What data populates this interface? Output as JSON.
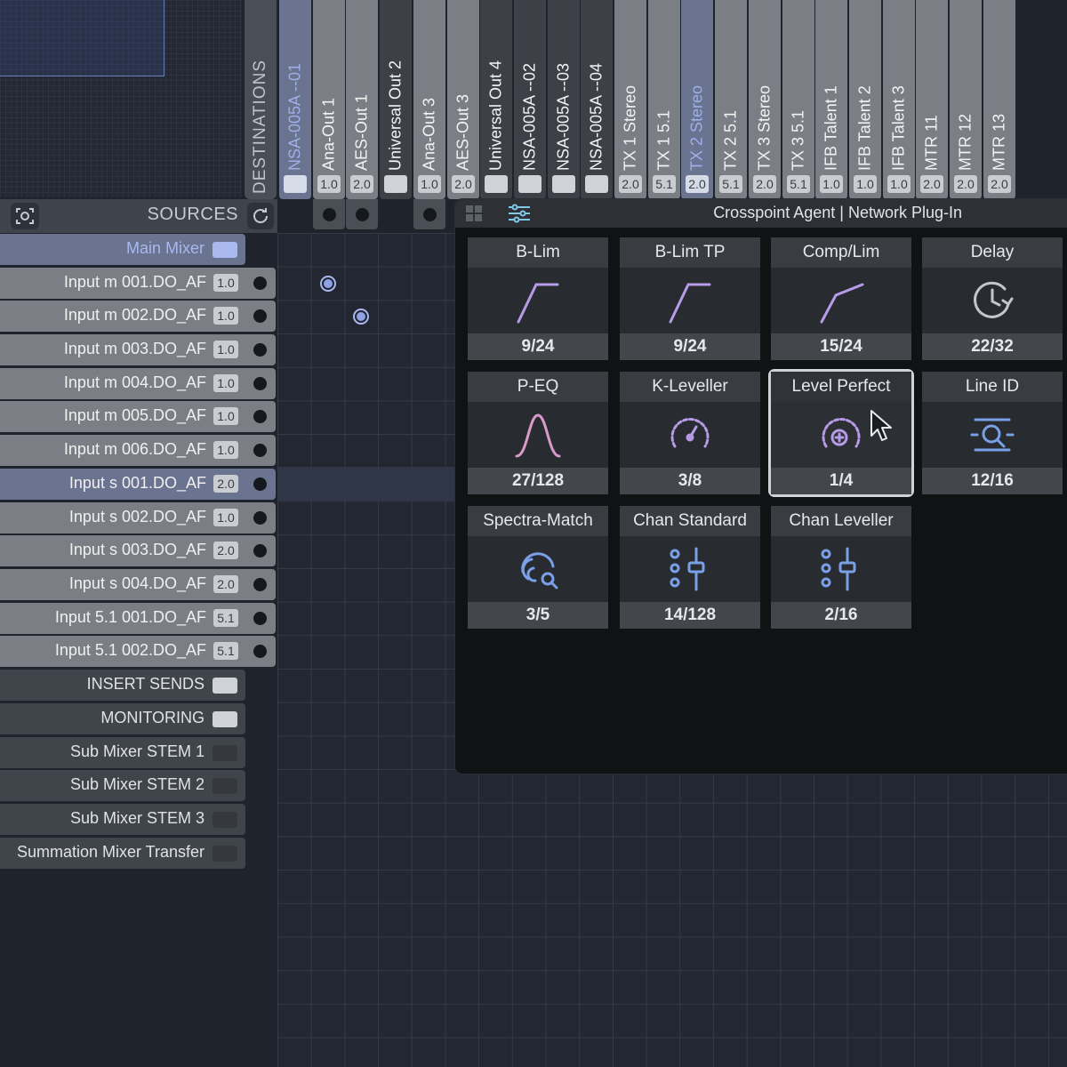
{
  "header": {
    "destinations_label": "DESTINATIONS"
  },
  "sources_bar": {
    "label": "SOURCES"
  },
  "destinations": [
    {
      "name": "NSA-005A --01",
      "badge": ""
    },
    {
      "name": "Ana-Out 1",
      "badge": "1.0"
    },
    {
      "name": "AES-Out 1",
      "badge": "2.0"
    },
    {
      "name": "Universal Out 2",
      "badge": ""
    },
    {
      "name": "Ana-Out 3",
      "badge": "1.0"
    },
    {
      "name": "AES-Out 3",
      "badge": "2.0"
    },
    {
      "name": "Universal Out 4",
      "badge": ""
    },
    {
      "name": "NSA-005A --02",
      "badge": ""
    },
    {
      "name": "NSA-005A --03",
      "badge": ""
    },
    {
      "name": "NSA-005A --04",
      "badge": ""
    },
    {
      "name": "TX 1 Stereo",
      "badge": "2.0"
    },
    {
      "name": "TX 1 5.1",
      "badge": "5.1"
    },
    {
      "name": "TX 2 Stereo",
      "badge": "2.0"
    },
    {
      "name": "TX 2 5.1",
      "badge": "5.1"
    },
    {
      "name": "TX 3 Stereo",
      "badge": "2.0"
    },
    {
      "name": "TX 3 5.1",
      "badge": "5.1"
    },
    {
      "name": "IFB Talent 1",
      "badge": "1.0"
    },
    {
      "name": "IFB Talent 2",
      "badge": "1.0"
    },
    {
      "name": "IFB Talent 3",
      "badge": "1.0"
    },
    {
      "name": "MTR 11",
      "badge": "2.0"
    },
    {
      "name": "MTR 12",
      "badge": "2.0"
    },
    {
      "name": "MTR 13",
      "badge": "2.0"
    }
  ],
  "sources": {
    "main_group": "Main Mixer",
    "inputs": [
      {
        "name": "Input m 001.DO_AF",
        "badge": "1.0"
      },
      {
        "name": "Input m 002.DO_AF",
        "badge": "1.0"
      },
      {
        "name": "Input m 003.DO_AF",
        "badge": "1.0"
      },
      {
        "name": "Input m 004.DO_AF",
        "badge": "1.0"
      },
      {
        "name": "Input m 005.DO_AF",
        "badge": "1.0"
      },
      {
        "name": "Input m 006.DO_AF",
        "badge": "1.0"
      },
      {
        "name": "Input s 001.DO_AF",
        "badge": "2.0"
      },
      {
        "name": "Input s 002.DO_AF",
        "badge": "1.0"
      },
      {
        "name": "Input s 003.DO_AF",
        "badge": "2.0"
      },
      {
        "name": "Input s 004.DO_AF",
        "badge": "2.0"
      },
      {
        "name": "Input 5.1 001.DO_AF",
        "badge": "5.1"
      },
      {
        "name": "Input 5.1 002.DO_AF",
        "badge": "5.1"
      }
    ],
    "groups": [
      "INSERT SENDS",
      "MONITORING",
      "Sub Mixer STEM 1",
      "Sub Mixer STEM 2",
      "Sub Mixer STEM 3",
      "Summation Mixer Transfer"
    ]
  },
  "plugin_panel": {
    "title": "Crosspoint Agent | Network Plug-In",
    "tiles": [
      {
        "name": "B-Lim",
        "count": "9/24",
        "icon": "limiter-curve-icon"
      },
      {
        "name": "B-Lim TP",
        "count": "9/24",
        "icon": "limiter-curve-icon"
      },
      {
        "name": "Comp/Lim",
        "count": "15/24",
        "icon": "compressor-curve-icon"
      },
      {
        "name": "Delay",
        "count": "22/32",
        "icon": "clock-delay-icon"
      },
      {
        "name": "P-EQ",
        "count": "27/128",
        "icon": "bell-curve-icon"
      },
      {
        "name": "K-Leveller",
        "count": "3/8",
        "icon": "gauge-icon"
      },
      {
        "name": "Level Perfect",
        "count": "1/4",
        "icon": "level-plus-icon"
      },
      {
        "name": "Line ID",
        "count": "12/16",
        "icon": "line-search-icon"
      },
      {
        "name": "Spectra-Match",
        "count": "3/5",
        "icon": "fingerprint-search-icon"
      },
      {
        "name": "Chan Standard",
        "count": "14/128",
        "icon": "fader-icon"
      },
      {
        "name": "Chan Leveller",
        "count": "2/16",
        "icon": "fader-icon"
      }
    ]
  },
  "colors": {
    "accent": "#a9b8ee",
    "purple": "#b89be8",
    "pink": "#d89acb",
    "blue": "#7aa0e8"
  }
}
